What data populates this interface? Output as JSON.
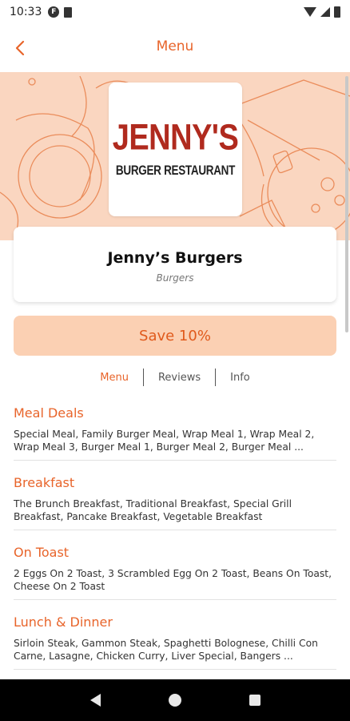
{
  "status_bar": {
    "time": "10:33",
    "icons": [
      "app-notification-icon",
      "sim-card-icon",
      "wifi-icon",
      "signal-icon",
      "battery-icon"
    ]
  },
  "header": {
    "title": "Menu",
    "back_icon": "chevron-left-icon"
  },
  "logo": {
    "main_text": "JENNY'S",
    "sub_text": "BURGER RESTAURANT"
  },
  "restaurant": {
    "name": "Jenny’s Burgers",
    "category": "Burgers"
  },
  "offer": {
    "label": "Save 10%"
  },
  "tabs": [
    {
      "label": "Menu",
      "active": true
    },
    {
      "label": "Reviews",
      "active": false
    },
    {
      "label": "Info",
      "active": false
    }
  ],
  "menu_sections": [
    {
      "title": "Meal Deals",
      "items": "Special Meal, Family Burger Meal, Wrap Meal 1, Wrap Meal 2, Wrap Meal 3, Burger Meal 1, Burger Meal 2, Burger Meal ..."
    },
    {
      "title": "Breakfast",
      "items": "The Brunch Breakfast, Traditional Breakfast, Special Grill Breakfast, Pancake Breakfast, Vegetable Breakfast"
    },
    {
      "title": "On Toast",
      "items": "2 Eggs On 2 Toast, 3 Scrambled Egg On 2 Toast, Beans On Toast, Cheese On 2 Toast"
    },
    {
      "title": "Lunch & Dinner",
      "items": "Sirloin Steak, Gammon Steak, Spaghetti Bolognese, Chilli Con Carne, Lasagne, Chicken Curry, Liver Special, Bangers ..."
    }
  ],
  "colors": {
    "accent": "#e8642a",
    "hero_bg": "#fad6c0",
    "offer_bg": "#fbd0b3",
    "logo_red": "#b02a1e"
  },
  "nav_bar": {
    "icons": [
      "nav-back-icon",
      "nav-home-icon",
      "nav-recents-icon"
    ]
  }
}
